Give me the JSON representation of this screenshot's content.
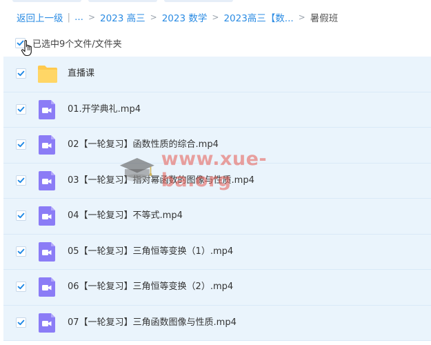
{
  "breadcrumb": {
    "back_label": "返回上一级",
    "separator": "|",
    "ellipsis": "...",
    "arrow": ">",
    "items": [
      "2023 高三",
      "2023 数学",
      "2023高三【数..."
    ],
    "current": "暑假班"
  },
  "selection": {
    "checked": true,
    "summary": "已选中9个文件/文件夹"
  },
  "files": [
    {
      "name": "直播课",
      "type": "folder",
      "checked": true
    },
    {
      "name": "01.开学典礼.mp4",
      "type": "video",
      "checked": true
    },
    {
      "name": "02【一轮复习】函数性质的综合.mp4",
      "type": "video",
      "checked": true
    },
    {
      "name": "03【一轮复习】指对幂函数的图像与性质.mp4",
      "type": "video",
      "checked": true
    },
    {
      "name": "04【一轮复习】不等式.mp4",
      "type": "video",
      "checked": true
    },
    {
      "name": "05【一轮复习】三角恒等变换（1）.mp4",
      "type": "video",
      "checked": true
    },
    {
      "name": "06【一轮复习】三角恒等变换（2）.mp4",
      "type": "video",
      "checked": true
    },
    {
      "name": "07【一轮复习】三角函数图像与性质.mp4",
      "type": "video",
      "checked": true
    }
  ],
  "watermark": {
    "text": "www.xue-ba.org",
    "icon": "graduation-cap-icon"
  },
  "colors": {
    "link": "#2a8be3",
    "row_bg": "#eaf4fc",
    "checkbox_check": "#1e88e5",
    "folder": "#ffc94d",
    "video_icon": "#8b7cf6",
    "watermark": "#e65a50"
  },
  "icons": {
    "checkbox": "checkmark-icon",
    "folder": "folder-icon",
    "video": "video-file-icon",
    "cursor": "hand-pointer-icon"
  }
}
